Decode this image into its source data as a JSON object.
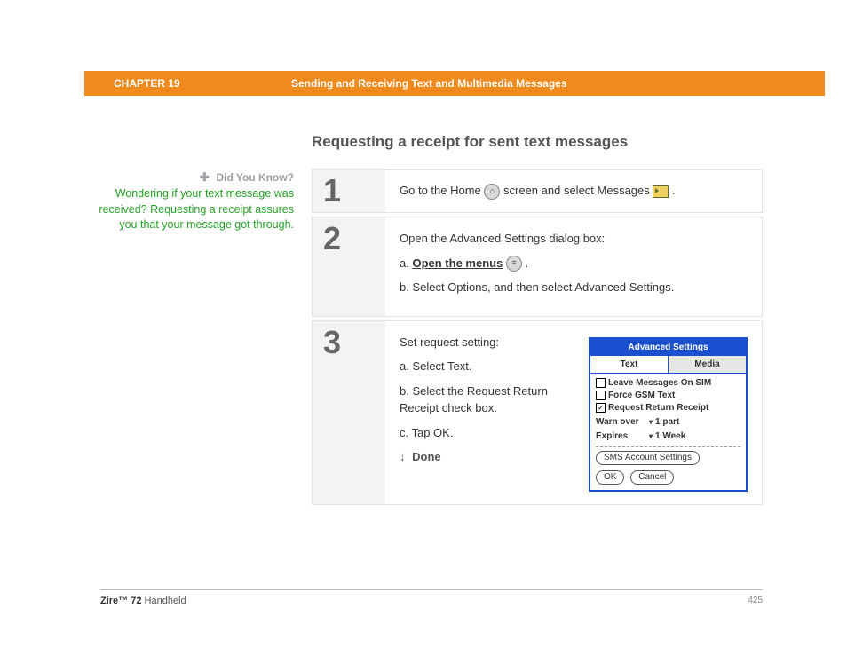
{
  "header": {
    "chapter": "CHAPTER 19",
    "title": "Sending and Receiving Text and Multimedia Messages"
  },
  "section_title": "Requesting a receipt for sent text messages",
  "sidebar": {
    "heading": "Did You Know?",
    "body": "Wondering if your text message was received? Requesting a receipt assures you that your message got through."
  },
  "steps": {
    "s1": {
      "num": "1",
      "pre": "Go to the Home ",
      "mid": " screen and select Messages ",
      "post": " ."
    },
    "s2": {
      "num": "2",
      "intro": "Open the Advanced Settings dialog box:",
      "a_prefix": "a.  ",
      "a_link": "Open the menus",
      "a_post": " .",
      "b": "b.  Select Options, and then select Advanced Settings."
    },
    "s3": {
      "num": "3",
      "intro": "Set request setting:",
      "a": "a.  Select Text.",
      "b": "b.  Select the Request Return Receipt check box.",
      "c": "c.  Tap OK.",
      "done": "Done"
    }
  },
  "screenshot": {
    "title": "Advanced Settings",
    "tab_text": "Text",
    "tab_media": "Media",
    "opt1": "Leave Messages On SIM",
    "opt2": "Force GSM Text",
    "opt3": "Request Return Receipt",
    "warn_label": "Warn over",
    "warn_value": "1 part",
    "exp_label": "Expires",
    "exp_value": "1 Week",
    "sms_btn": "SMS Account Settings",
    "ok": "OK",
    "cancel": "Cancel"
  },
  "footer": {
    "product": "Zire™ 72",
    "suffix": " Handheld",
    "page": "425"
  }
}
